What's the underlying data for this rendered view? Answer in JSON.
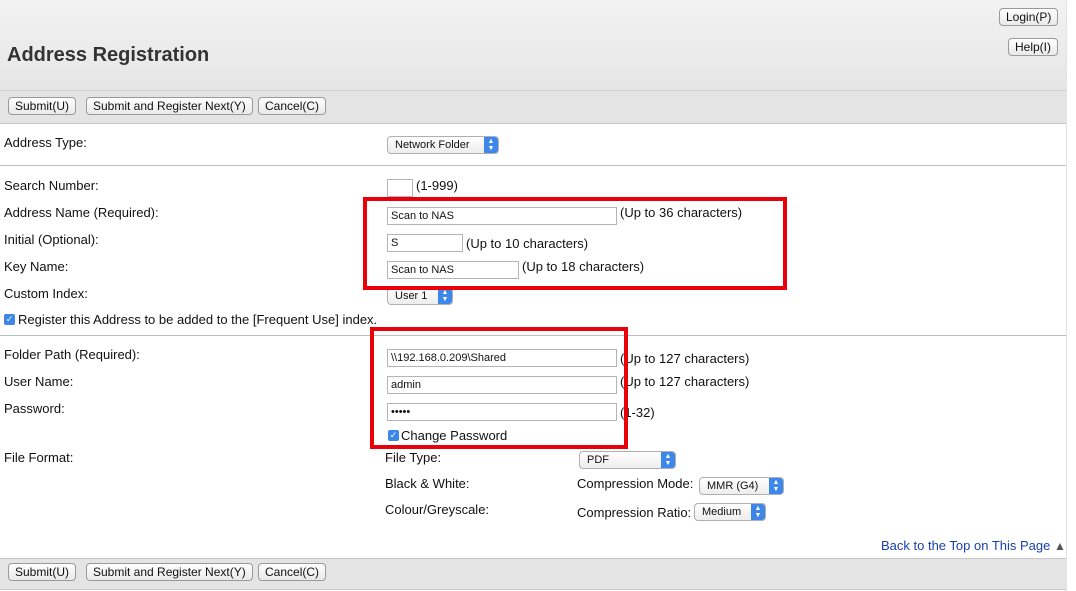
{
  "header": {
    "title": "Address Registration",
    "login_label": "Login(P)",
    "help_label": "Help(I)"
  },
  "toolbar": {
    "submit_label": "Submit(U)",
    "submit_next_label": "Submit and Register Next(Y)",
    "cancel_label": "Cancel(C)"
  },
  "form": {
    "address_type": {
      "label": "Address Type:",
      "value": "Network Folder"
    },
    "search_number": {
      "label": "Search Number:",
      "value": "",
      "hint": "(1-999)"
    },
    "address_name": {
      "label": "Address Name (Required):",
      "value": "Scan to NAS",
      "hint": "(Up to 36 characters)"
    },
    "initial": {
      "label": "Initial (Optional):",
      "value": "S",
      "hint": "(Up to 10 characters)"
    },
    "key_name": {
      "label": "Key Name:",
      "value": "Scan to NAS",
      "hint": "(Up to 18 characters)"
    },
    "custom_index": {
      "label": "Custom Index:",
      "value": "User 1"
    },
    "frequent_use": {
      "label": "Register this Address to be added to the [Frequent Use] index.",
      "checked": true
    },
    "folder_path": {
      "label": "Folder Path (Required):",
      "value": "\\\\192.168.0.209\\Shared",
      "hint": "(Up to 127 characters)"
    },
    "user_name": {
      "label": "User Name:",
      "value": "admin",
      "hint": "(Up to 127 characters)"
    },
    "password": {
      "label": "Password:",
      "value": "•••••",
      "hint": "(1-32)"
    },
    "change_password": {
      "label": "Change Password",
      "checked": true
    },
    "file_format": {
      "label": "File Format:",
      "file_type_label": "File Type:",
      "file_type_value": "PDF",
      "bw_label": "Black & White:",
      "compression_mode_label": "Compression Mode:",
      "compression_mode_value": "MMR (G4)",
      "colour_label": "Colour/Greyscale:",
      "compression_ratio_label": "Compression Ratio:",
      "compression_ratio_value": "Medium"
    }
  },
  "back_to_top_label": "Back to the Top on This Page",
  "icons": [
    "up-down-arrows-icon",
    "checkbox-checked-icon",
    "triangle-up-icon"
  ],
  "colors": {
    "highlight_box": "#e8000b",
    "accent": "#3d86ea",
    "link": "#1a3fae"
  }
}
